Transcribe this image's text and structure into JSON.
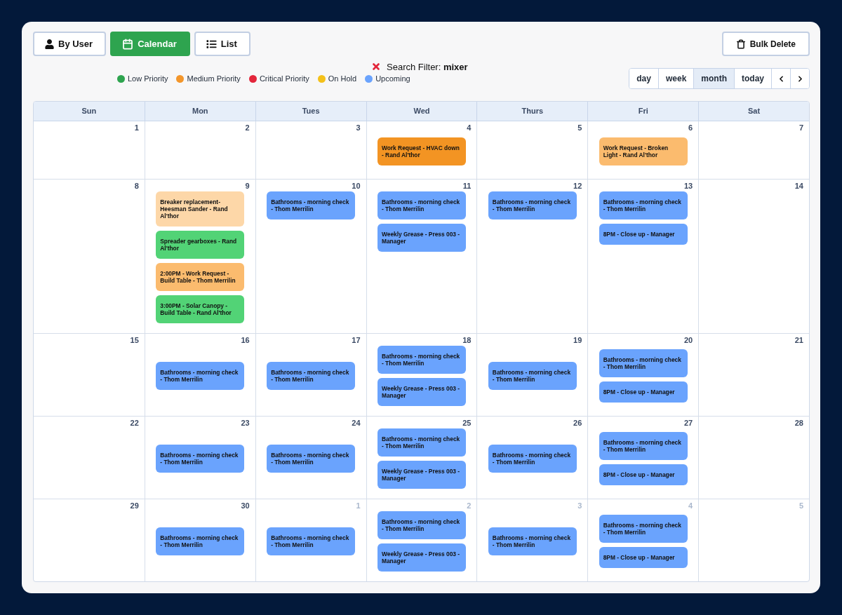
{
  "view_tabs": [
    {
      "label": "By User",
      "selected": false
    },
    {
      "label": "Calendar",
      "selected": true
    },
    {
      "label": "List",
      "selected": false
    }
  ],
  "bulk_delete_button": "Bulk Delete",
  "legend": [
    {
      "label": "Low Priority",
      "color": "#2ea44f"
    },
    {
      "label": "Medium Priority",
      "color": "#f3962b"
    },
    {
      "label": "Critical Priority",
      "color": "#e3263b"
    },
    {
      "label": "On Hold",
      "color": "#f4c11a"
    },
    {
      "label": "Upcoming",
      "color": "#6aa3fd"
    }
  ],
  "search_filter": "Search Filter: **mixer**",
  "range_buttons": [
    {
      "label": "day",
      "selected": false
    },
    {
      "label": "week",
      "selected": false
    },
    {
      "label": "month",
      "selected": true
    }
  ],
  "today_button": "today",
  "calendar": {
    "weekdays": [
      "Sun",
      "Mon",
      "Tues",
      "Wed",
      "Thurs",
      "Fri",
      "Sat"
    ],
    "weeks": [
      {
        "days": [
          {
            "date": "1",
            "outside_month": false
          },
          {
            "date": "2",
            "outside_month": false
          },
          {
            "date": "3",
            "outside_month": false
          },
          {
            "date": "4",
            "outside_month": false,
            "events": [
              {
                "title": "Work Request - HVAC down - Rand Al'thor",
                "color": "#f39423"
              }
            ]
          },
          {
            "date": "5",
            "outside_month": false
          },
          {
            "date": "6",
            "outside_month": false,
            "events": [
              {
                "title": "Work Request - Broken Light - Rand Al'thor",
                "color": "#fbbb6e"
              }
            ]
          },
          {
            "date": "7",
            "outside_month": false
          }
        ]
      },
      {
        "days": [
          {
            "date": "8",
            "outside_month": false
          },
          {
            "date": "9",
            "outside_month": false,
            "events": [
              {
                "title": "Breaker replacement- Heesman Sander - Rand Al'thor",
                "color": "#fdd7a8"
              },
              {
                "title": "Spreader gearboxes - Rand Al'thor",
                "color": "#52d376"
              },
              {
                "title": "2:00PM - Work Request - Build Table - Thom Merrilin",
                "color": "#fbbb6e"
              },
              {
                "title": "3:00PM - Solar Canopy - Build Table - Rand Al'thor",
                "color": "#52d376"
              }
            ]
          },
          {
            "date": "10",
            "outside_month": false,
            "events": [
              {
                "title": "Bathrooms - morning check - Thom Merrilin",
                "color": "#6aa3fd"
              }
            ]
          },
          {
            "date": "11",
            "outside_month": false,
            "events": [
              {
                "title": "Bathrooms - morning check - Thom Merrilin",
                "color": "#6aa3fd"
              },
              {
                "title": "Weekly Grease - Press 003 - Manager",
                "color": "#6aa3fd"
              }
            ]
          },
          {
            "date": "12",
            "outside_month": false,
            "events": [
              {
                "title": "Bathrooms - morning check - Thom Merrilin",
                "color": "#6aa3fd"
              }
            ]
          },
          {
            "date": "13",
            "outside_month": false,
            "events": [
              {
                "title": "Bathrooms - morning check - Thom Merrilin",
                "color": "#6aa3fd"
              },
              {
                "title": "8PM - Close up - Manager",
                "color": "#6aa3fd"
              }
            ]
          },
          {
            "date": "14",
            "outside_month": false
          }
        ]
      },
      {
        "days": [
          {
            "date": "15",
            "outside_month": false
          },
          {
            "date": "16",
            "outside_month": false,
            "events": [
              {
                "title": "Bathrooms - morning check - Thom Merrilin",
                "color": "#6aa3fd"
              }
            ]
          },
          {
            "date": "17",
            "outside_month": false,
            "events": [
              {
                "title": "Bathrooms - morning check - Thom Merrilin",
                "color": "#6aa3fd"
              }
            ]
          },
          {
            "date": "18",
            "outside_month": false,
            "events": [
              {
                "title": "Bathrooms - morning check - Thom Merrilin",
                "color": "#6aa3fd"
              },
              {
                "title": "Weekly Grease - Press 003 - Manager",
                "color": "#6aa3fd"
              }
            ]
          },
          {
            "date": "19",
            "outside_month": false,
            "events": [
              {
                "title": "Bathrooms - morning check - Thom Merrilin",
                "color": "#6aa3fd"
              }
            ]
          },
          {
            "date": "20",
            "outside_month": false,
            "events": [
              {
                "title": "Bathrooms - morning check - Thom Merrilin",
                "color": "#6aa3fd"
              },
              {
                "title": "8PM - Close up - Manager",
                "color": "#6aa3fd"
              }
            ]
          },
          {
            "date": "21",
            "outside_month": false
          }
        ]
      },
      {
        "days": [
          {
            "date": "22",
            "outside_month": false
          },
          {
            "date": "23",
            "outside_month": false,
            "events": [
              {
                "title": "Bathrooms - morning check - Thom Merrilin",
                "color": "#6aa3fd"
              }
            ]
          },
          {
            "date": "24",
            "outside_month": false,
            "events": [
              {
                "title": "Bathrooms - morning check - Thom Merrilin",
                "color": "#6aa3fd"
              }
            ]
          },
          {
            "date": "25",
            "outside_month": false,
            "events": [
              {
                "title": "Bathrooms - morning check - Thom Merrilin",
                "color": "#6aa3fd"
              },
              {
                "title": "Weekly Grease - Press 003 - Manager",
                "color": "#6aa3fd"
              }
            ]
          },
          {
            "date": "26",
            "outside_month": false,
            "events": [
              {
                "title": "Bathrooms - morning check - Thom Merrilin",
                "color": "#6aa3fd"
              }
            ]
          },
          {
            "date": "27",
            "outside_month": false,
            "events": [
              {
                "title": "Bathrooms - morning check - Thom Merrilin",
                "color": "#6aa3fd"
              },
              {
                "title": "8PM - Close up - Manager",
                "color": "#6aa3fd"
              }
            ]
          },
          {
            "date": "28",
            "outside_month": false
          }
        ]
      },
      {
        "days": [
          {
            "date": "29",
            "outside_month": false
          },
          {
            "date": "30",
            "outside_month": false,
            "events": [
              {
                "title": "Bathrooms - morning check - Thom Merrilin",
                "color": "#6aa3fd"
              }
            ]
          },
          {
            "date": "1",
            "outside_month": true,
            "events": [
              {
                "title": "Bathrooms - morning check - Thom Merrilin",
                "color": "#6aa3fd"
              }
            ]
          },
          {
            "date": "2",
            "outside_month": true,
            "events": [
              {
                "title": "Bathrooms - morning check - Thom Merrilin",
                "color": "#6aa3fd"
              },
              {
                "title": "Weekly Grease - Press 003 - Manager",
                "color": "#6aa3fd"
              }
            ]
          },
          {
            "date": "3",
            "outside_month": true,
            "events": [
              {
                "title": "Bathrooms - morning check - Thom Merrilin",
                "color": "#6aa3fd"
              }
            ]
          },
          {
            "date": "4",
            "outside_month": true,
            "events": [
              {
                "title": "Bathrooms - morning check - Thom Merrilin",
                "color": "#6aa3fd"
              },
              {
                "title": "8PM - Close up - Manager",
                "color": "#6aa3fd"
              }
            ]
          },
          {
            "date": "5",
            "outside_month": true
          }
        ]
      }
    ]
  }
}
